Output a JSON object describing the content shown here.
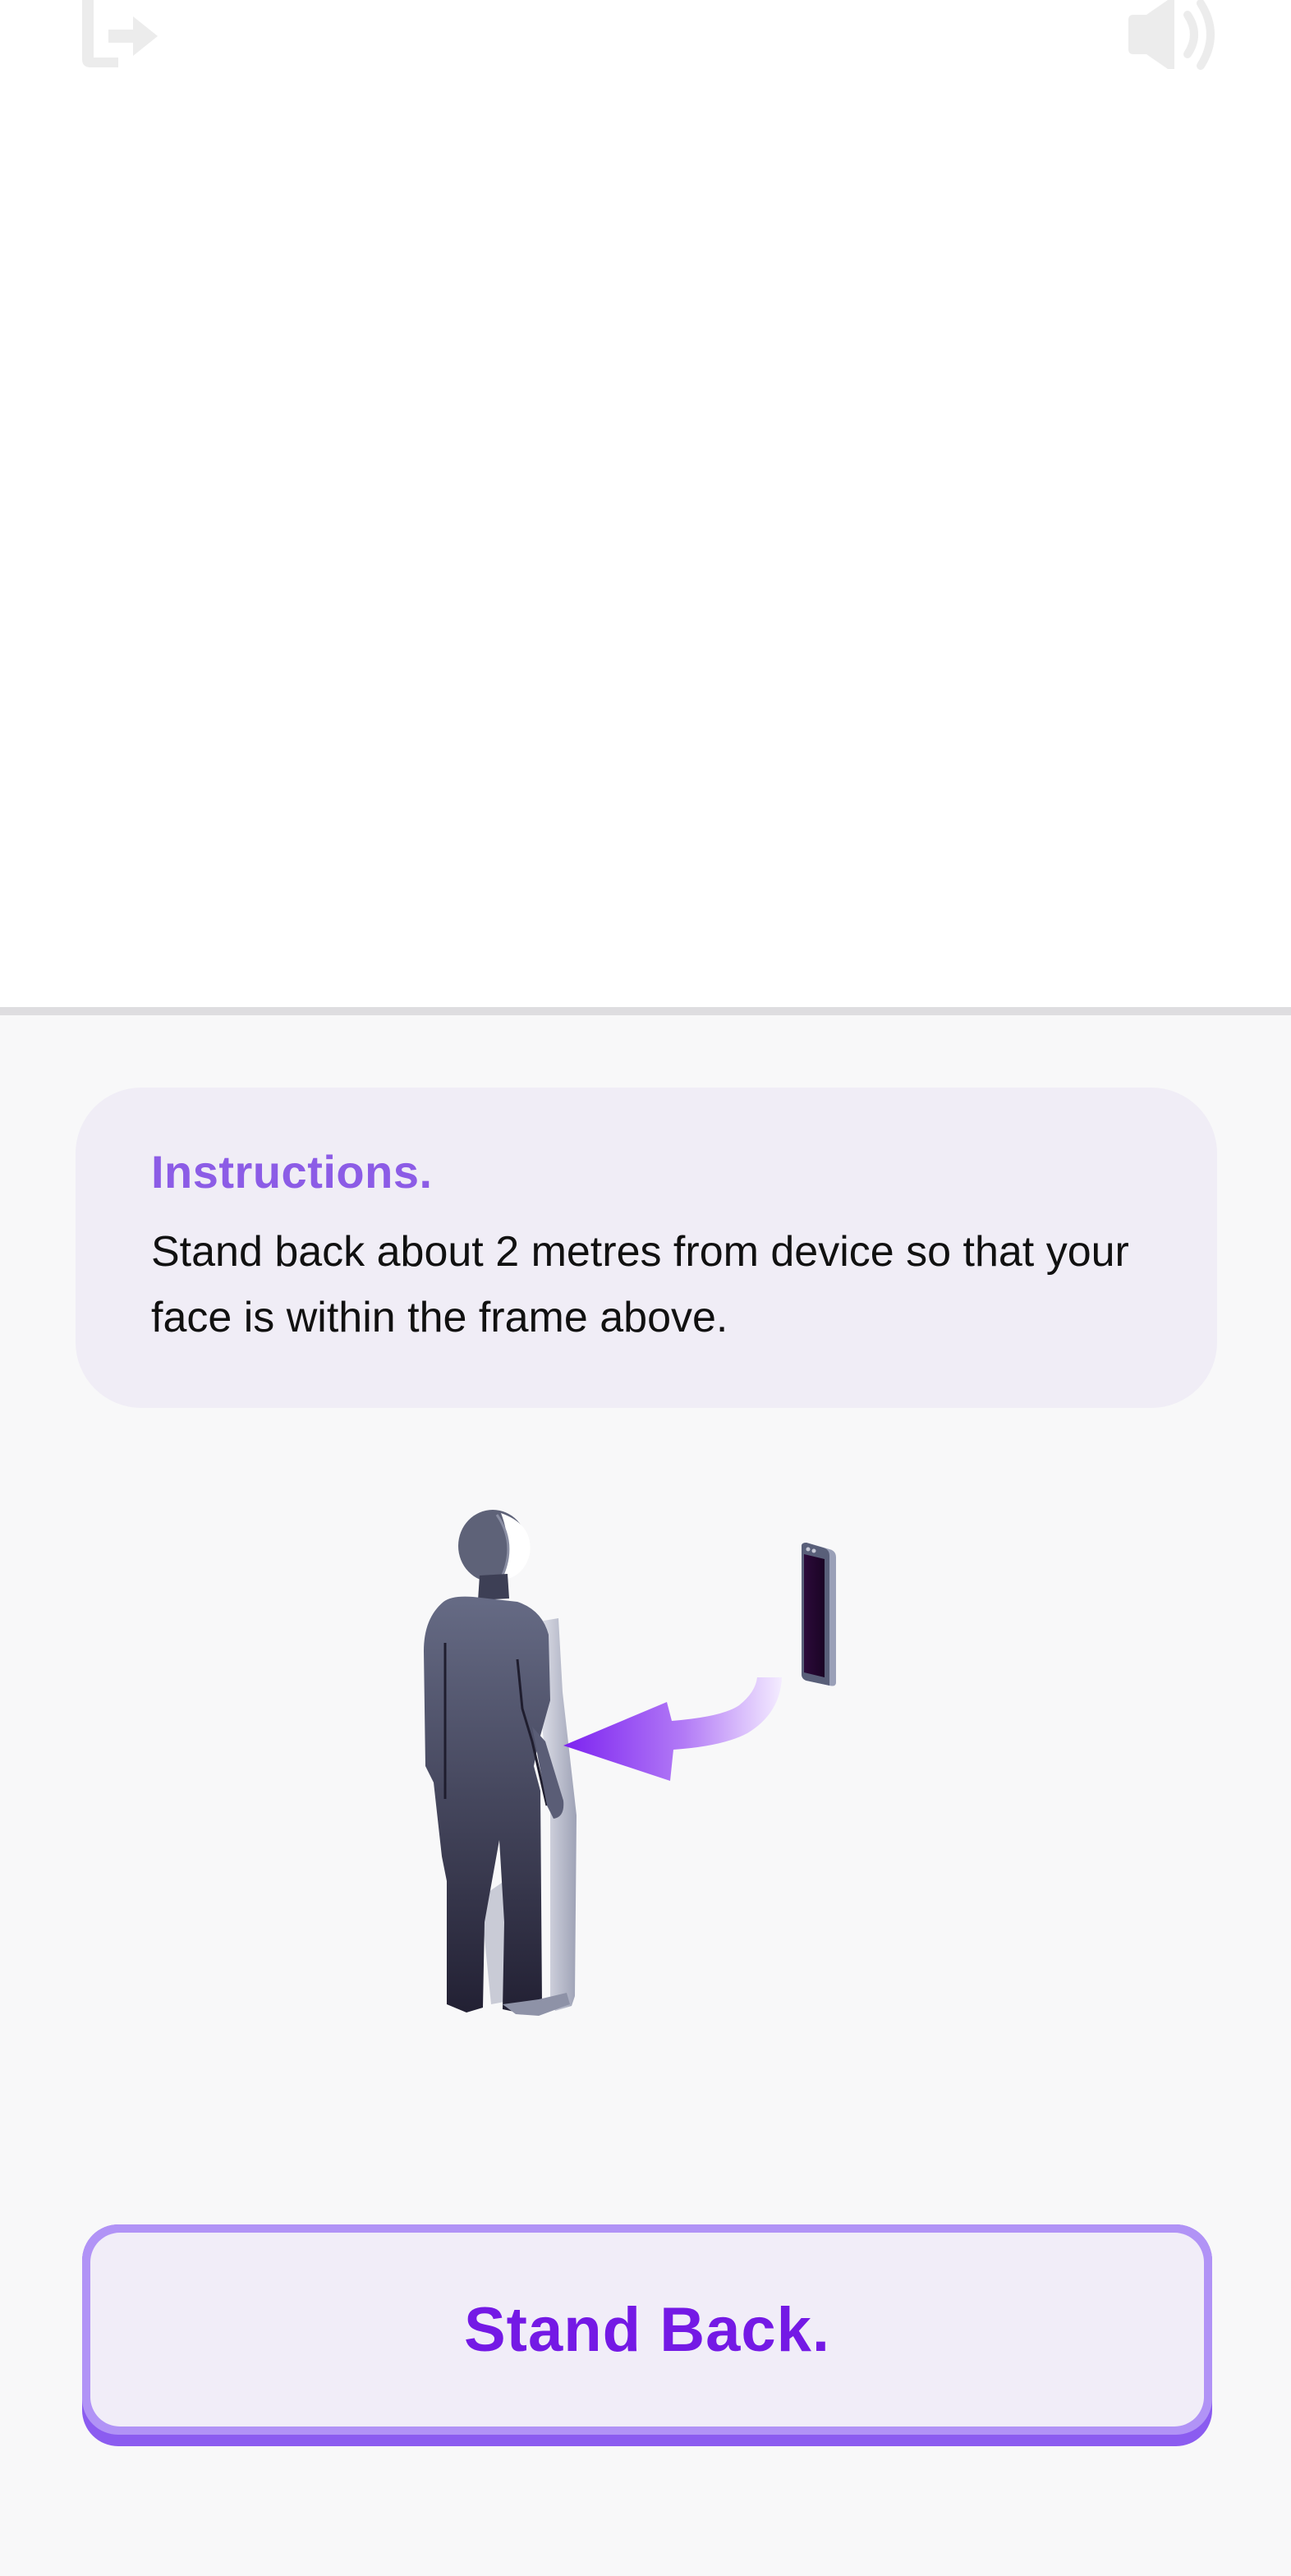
{
  "camera": {},
  "top_bar": {
    "exit_icon": "exit-icon",
    "sound_icon": "speaker-icon"
  },
  "instructions": {
    "title": "Instructions.",
    "body": "Stand back about 2 metres from device so that your face is within the frame above."
  },
  "illustration": {
    "figure": "person-figure",
    "arrow": "arrow-left-icon",
    "device": "phone-icon"
  },
  "primary_action": {
    "label": "Stand Back."
  },
  "colors": {
    "accent": "#8c5ce6",
    "button_text": "#7419e5",
    "card_bg": "#f0edf6",
    "button_border": "#b193f6",
    "button_shadow": "#8b5cf0"
  }
}
